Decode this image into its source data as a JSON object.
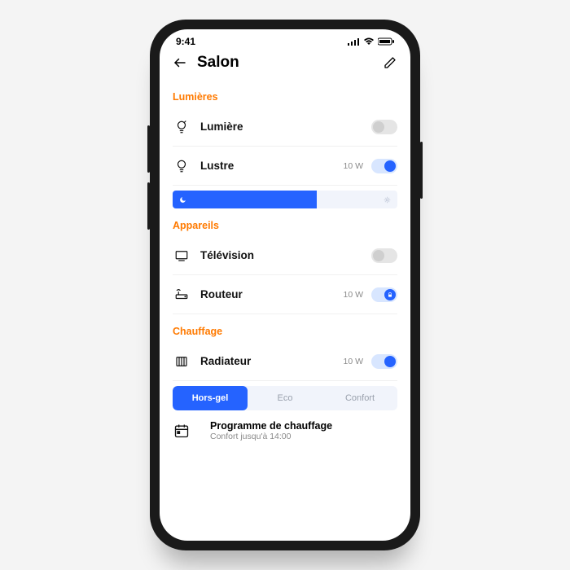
{
  "status": {
    "time": "9:41"
  },
  "header": {
    "title": "Salon"
  },
  "sections": {
    "lights": {
      "title": "Lumières",
      "items": [
        {
          "label": "Lumière",
          "watt": "",
          "on": false
        },
        {
          "label": "Lustre",
          "watt": "10 W",
          "on": true
        }
      ]
    },
    "devices": {
      "title": "Appareils",
      "items": [
        {
          "label": "Télévision",
          "watt": "",
          "on": false
        },
        {
          "label": "Routeur",
          "watt": "10 W",
          "locked": true
        }
      ]
    },
    "heating": {
      "title": "Chauffage",
      "items": [
        {
          "label": "Radiateur",
          "watt": "10 W",
          "on": true
        }
      ],
      "modes": {
        "a": "Hors-gel",
        "b": "Eco",
        "c": "Confort"
      },
      "program": {
        "title": "Programme de chauffage",
        "sub": "Confort jusqu'à 14:00"
      }
    }
  }
}
